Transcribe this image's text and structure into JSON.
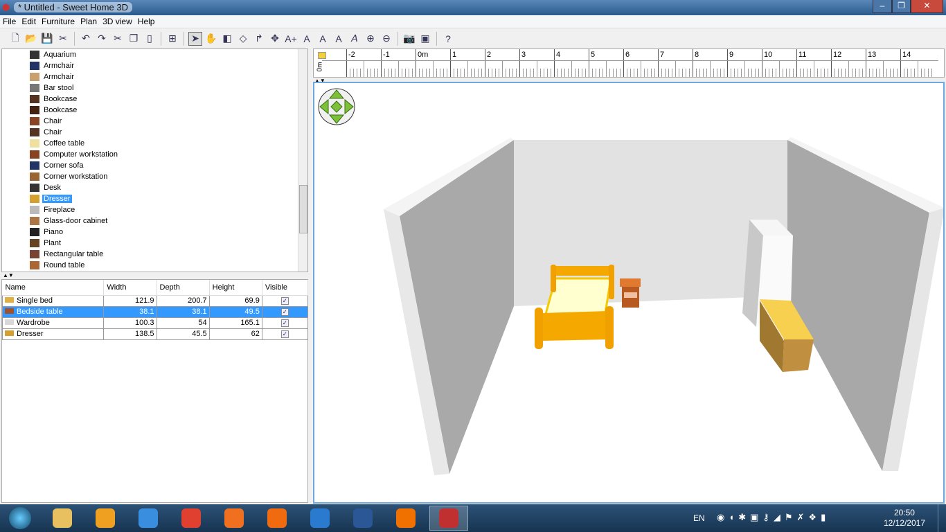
{
  "window": {
    "title": "* Untitled - Sweet Home 3D"
  },
  "menu": [
    "File",
    "Edit",
    "Furniture",
    "Plan",
    "3D view",
    "Help"
  ],
  "toolbar": [
    {
      "icon": "new-icon"
    },
    {
      "icon": "open-icon"
    },
    {
      "icon": "save-icon"
    },
    {
      "icon": "preferences-icon"
    },
    {
      "sep": true
    },
    {
      "icon": "undo-icon"
    },
    {
      "icon": "redo-icon"
    },
    {
      "icon": "cut-icon"
    },
    {
      "icon": "copy-icon"
    },
    {
      "icon": "paste-icon"
    },
    {
      "sep": true
    },
    {
      "icon": "add-furniture-icon"
    },
    {
      "sep": true
    },
    {
      "icon": "select-icon",
      "selected": true
    },
    {
      "icon": "pan-icon"
    },
    {
      "icon": "create-walls-icon"
    },
    {
      "icon": "create-rooms-icon"
    },
    {
      "icon": "create-polylines-icon"
    },
    {
      "icon": "create-dimensions-icon"
    },
    {
      "icon": "add-text-icon"
    },
    {
      "icon": "increase-text-icon"
    },
    {
      "icon": "decrease-text-icon"
    },
    {
      "icon": "bold-text-icon"
    },
    {
      "icon": "italic-text-icon"
    },
    {
      "icon": "zoom-in-icon"
    },
    {
      "icon": "zoom-out-icon"
    },
    {
      "sep": true
    },
    {
      "icon": "create-photo-icon"
    },
    {
      "icon": "create-video-icon"
    },
    {
      "sep": true
    },
    {
      "icon": "help-icon"
    }
  ],
  "catalog": {
    "items": [
      {
        "label": "Aquarium"
      },
      {
        "label": "Armchair"
      },
      {
        "label": "Armchair"
      },
      {
        "label": "Bar stool"
      },
      {
        "label": "Bookcase"
      },
      {
        "label": "Bookcase"
      },
      {
        "label": "Chair"
      },
      {
        "label": "Chair"
      },
      {
        "label": "Coffee table"
      },
      {
        "label": "Computer workstation"
      },
      {
        "label": "Corner sofa"
      },
      {
        "label": "Corner workstation"
      },
      {
        "label": "Desk"
      },
      {
        "label": "Dresser",
        "selected": true
      },
      {
        "label": "Fireplace"
      },
      {
        "label": "Glass-door cabinet"
      },
      {
        "label": "Piano"
      },
      {
        "label": "Plant"
      },
      {
        "label": "Rectangular table"
      },
      {
        "label": "Round table"
      }
    ]
  },
  "furniture_table": {
    "columns": [
      "Name",
      "Width",
      "Depth",
      "Height",
      "Visible"
    ],
    "rows": [
      {
        "name": "Single bed",
        "width": "121.9",
        "depth": "200.7",
        "height": "69.9",
        "visible": true,
        "color": "#e0b040"
      },
      {
        "name": "Bedside table",
        "width": "38.1",
        "depth": "38.1",
        "height": "49.5",
        "visible": true,
        "selected": true,
        "color": "#a0522d"
      },
      {
        "name": "Wardrobe",
        "width": "100.3",
        "depth": "54",
        "height": "165.1",
        "visible": true,
        "color": "#d8d8d8"
      },
      {
        "name": "Dresser",
        "width": "138.5",
        "depth": "45.5",
        "height": "62",
        "visible": true,
        "color": "#d4a030"
      }
    ]
  },
  "ruler": {
    "labels": [
      "-2",
      "-1",
      "0m",
      "1",
      "2",
      "3",
      "4",
      "5",
      "6",
      "7",
      "8",
      "9",
      "10",
      "11",
      "12",
      "13",
      "14"
    ],
    "vertical_label": "0m"
  },
  "taskbar": {
    "language": "EN",
    "time": "20:50",
    "date": "12/12/2017"
  },
  "colors": {
    "selection": "#3399ff",
    "bed": "#f5a800",
    "view_border": "#6fa8dc"
  }
}
